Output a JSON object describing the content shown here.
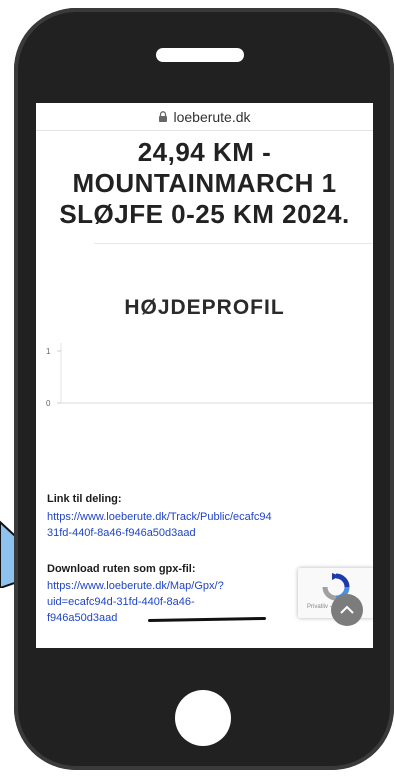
{
  "browser": {
    "url": "loeberute.dk",
    "lock_icon": "lock-icon"
  },
  "route": {
    "title": "24,94 KM - MOUNTAINMARCH 1 SLØJFE 0-25 KM 2024."
  },
  "elevation_profile": {
    "heading": "HØJDEPROFIL"
  },
  "chart_data": {
    "type": "line",
    "title": "",
    "xlabel": "",
    "ylabel": "",
    "ylim": [
      0,
      1
    ],
    "y_ticks": [
      "1",
      "0"
    ],
    "series": [
      {
        "values": []
      }
    ],
    "grid": false
  },
  "share": {
    "label": "Link til deling:",
    "url": "https://www.loeberute.dk/Track/Public/ecafc94\n31fd-440f-8a46-f946a50d3aad"
  },
  "download": {
    "label": "Download ruten som gpx-fil:",
    "url": "https://www.loeberute.dk/Map/Gpx/?\nuid=ecafc94d-31fd-440f-8a46-\nf946a50d3aad"
  },
  "recaptcha": {
    "text": "Privatliv - Vilkår"
  },
  "colors": {
    "link": "#1f45c6",
    "phone_body": "#212121",
    "arrow": "#8ec3f0"
  }
}
